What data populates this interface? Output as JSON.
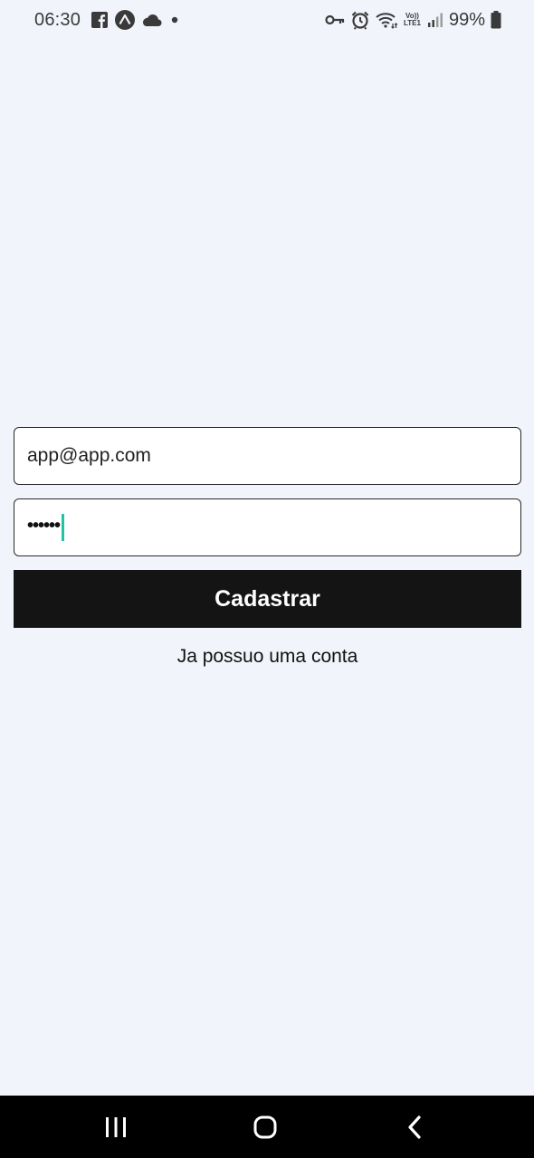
{
  "status_bar": {
    "time": "06:30",
    "left_icons": [
      "facebook-icon",
      "expo-icon",
      "cloud-icon",
      "dot-icon"
    ],
    "right_icons": [
      "vpn-key-icon",
      "alarm-icon",
      "wifi-icon",
      "volte-icon",
      "signal-icon",
      "battery-icon"
    ],
    "volte_top": "Vo))",
    "volte_bottom": "LTE1",
    "battery": "99%"
  },
  "form": {
    "email_value": "app@app.com",
    "password_value": "••••••",
    "submit_label": "Cadastrar",
    "login_link": "Ja possuo uma conta"
  },
  "nav_bar": {
    "buttons": [
      "recent-apps-icon",
      "home-icon",
      "back-icon"
    ]
  },
  "colors": {
    "background": "#f1f4fb",
    "button": "#141414",
    "caret": "#22c3a6"
  }
}
